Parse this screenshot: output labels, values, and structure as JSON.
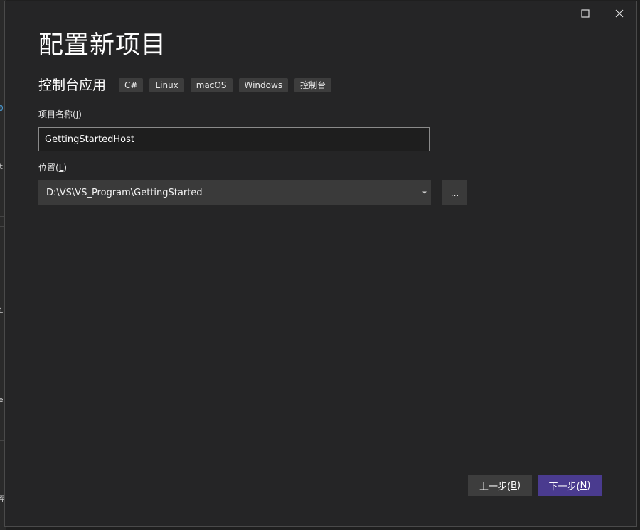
{
  "background": {
    "glyphs": [
      "0",
      "t",
      "i",
      "e",
      "至"
    ]
  },
  "window": {
    "maximize_icon": "maximize-icon",
    "close_icon": "close-icon"
  },
  "page": {
    "title": "配置新项目"
  },
  "template": {
    "name": "控制台应用",
    "tags": [
      "C#",
      "Linux",
      "macOS",
      "Windows",
      "控制台"
    ]
  },
  "project_name": {
    "label": "项目名称(",
    "label_key": "J",
    "label_end": ")",
    "value": "GettingStartedHost"
  },
  "location": {
    "label": "位置(",
    "label_key": "L",
    "label_end": ")",
    "value": "D:\\VS\\VS_Program\\GettingStarted",
    "browse_label": "..."
  },
  "footer": {
    "back_label": "上一步(",
    "back_key": "B",
    "next_label": "下一步(",
    "next_key": "N",
    "close_paren": ")"
  },
  "colors": {
    "dialog_bg": "#252526",
    "accent": "#4a3b8f",
    "tag_bg": "#3d3d3d"
  }
}
